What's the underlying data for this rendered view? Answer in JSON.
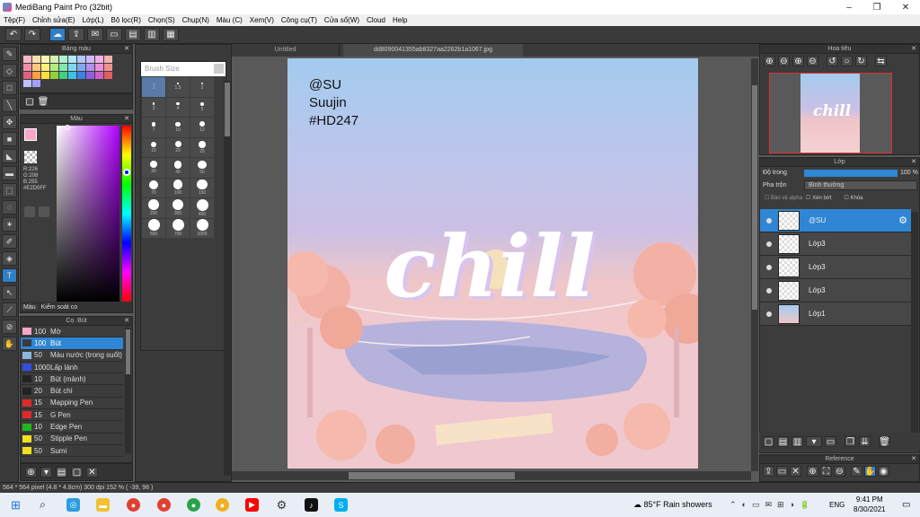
{
  "window": {
    "title": "MediBang Paint Pro (32bit)",
    "controls": [
      "–",
      "❐",
      "✕"
    ]
  },
  "menu": [
    "Tệp(F)",
    "Chỉnh sửa(E)",
    "Lớp(L)",
    "Bộ lọc(R)",
    "Chọn(S)",
    "Chụp(N)",
    "Màu (C)",
    "Xem(V)",
    "Công cụ(T)",
    "Cửa sổ(W)",
    "Cloud",
    "Help"
  ],
  "tabs": {
    "untitled": "Untitled",
    "file": "dd8090041355ab8327aa2262b1a1067.jpg"
  },
  "color_palette_panel": {
    "title": "Bảng màu"
  },
  "color_panel": {
    "title": "Màu",
    "r": "R:226",
    "g": "G:208",
    "b": "B:255",
    "hex": "#E2D0FF",
    "tab_color": "Màu",
    "tab_control": "Kiểm soát co"
  },
  "brush_panel": {
    "title": "Cọ. Bút",
    "items": [
      {
        "size": "100",
        "name": "Mờ",
        "color": "#f7a6c8"
      },
      {
        "size": "100",
        "name": "Bút",
        "color": "#3a3a3a",
        "selected": true
      },
      {
        "size": "50",
        "name": "Màu nước (trong suốt)",
        "color": "#8ab8e0"
      },
      {
        "size": "1000",
        "name": "Lấp lánh",
        "color": "#2e4fe0"
      },
      {
        "size": "10",
        "name": "Bút (mảnh)",
        "color": "#222"
      },
      {
        "size": "20",
        "name": "Bút chì",
        "color": "#222"
      },
      {
        "size": "15",
        "name": "Mapping Pen",
        "color": "#e02a2a"
      },
      {
        "size": "15",
        "name": "G Pen",
        "color": "#e02a2a"
      },
      {
        "size": "10",
        "name": "Edge Pen",
        "color": "#1fb61f"
      },
      {
        "size": "50",
        "name": "Stipple Pen",
        "color": "#f0e020"
      },
      {
        "size": "50",
        "name": "Sumi",
        "color": "#f0e020"
      }
    ]
  },
  "brush_size": {
    "title": "Brush Size",
    "sizes": [
      "1",
      "1.5",
      "2",
      "3",
      "4",
      "5",
      "7",
      "10",
      "12",
      "15",
      "20",
      "25",
      "30",
      "40",
      "50",
      "70",
      "100",
      "150",
      "200",
      "300",
      "400",
      "500",
      "700",
      "1000"
    ]
  },
  "navigator": {
    "title": "Hoa tiêu"
  },
  "canvas_text": {
    "line1": "@SU",
    "line2": "Suujin",
    "line3": "#HD247",
    "big_word": "chill"
  },
  "layer_panel": {
    "title": "Lớp",
    "opacity_label": "Độ trong",
    "opacity_value": "100 %",
    "blend_label": "Pha trộn",
    "blend_value": "Bình thường",
    "protect_alpha": "Bảo vệ alpha",
    "clipping": "Xén bớt",
    "lock": "Khóa",
    "layers": [
      {
        "name": "@SU",
        "selected": true
      },
      {
        "name": "Lớp3"
      },
      {
        "name": "Lớp3"
      },
      {
        "name": "Lớp3"
      },
      {
        "name": "Lớp1"
      }
    ]
  },
  "reference_panel": {
    "title": "Reference"
  },
  "status": "564 * 564 pixel   (4.8 * 4.8cm)   300 dpi   152 %   ( -39, 98 )",
  "taskbar": {
    "weather": "85°F  Rain showers",
    "lang": "ENG",
    "time": "9:41 PM",
    "date": "8/30/2021"
  },
  "colors": {
    "accent": "#2f86d4",
    "fg_swatch": "#f7a6c8",
    "canvas_top": "#9fc8ee",
    "canvas_bottom": "#f4d2d8"
  }
}
